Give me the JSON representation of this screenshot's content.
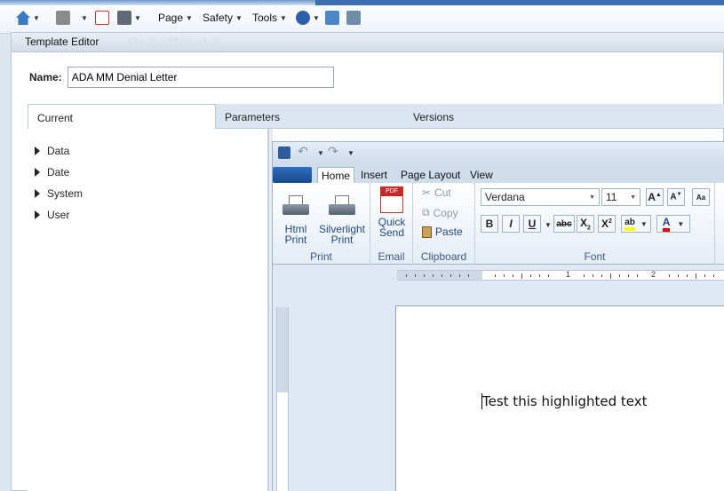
{
  "ie_toolbar": {
    "page_label": "Page",
    "safety_label": "Safety",
    "tools_label": "Tools"
  },
  "window": {
    "title": "Template Editor",
    "watermark": "CaseWorks"
  },
  "form": {
    "name_label": "Name:",
    "name_value": "ADA MM Denial Letter"
  },
  "tabs": [
    {
      "label": "Current"
    },
    {
      "label": "Parameters"
    },
    {
      "label": "Versions"
    }
  ],
  "tree": [
    {
      "label": "Data"
    },
    {
      "label": "Date"
    },
    {
      "label": "System"
    },
    {
      "label": "User"
    }
  ],
  "editor": {
    "ribbon_tabs": [
      "Home",
      "Insert",
      "Page Layout",
      "View"
    ],
    "print": {
      "html_line1": "Html",
      "html_line2": "Print",
      "sl_line1": "Silverlight",
      "sl_line2": "Print",
      "group": "Print"
    },
    "email": {
      "line1": "Quick",
      "line2": "Send",
      "group": "Email",
      "pdf_badge": "PDF"
    },
    "clipboard": {
      "cut": "Cut",
      "copy": "Copy",
      "paste": "Paste",
      "group": "Clipboard"
    },
    "font": {
      "family": "Verdana",
      "size": "11",
      "group": "Font"
    },
    "ruler": [
      "1",
      "2"
    ],
    "document_text": "Test this highlighted text"
  },
  "colors": {
    "accent": "#1f4a7d",
    "tab_strip": "#dbe5ef",
    "highlight": "#ffff00",
    "font_color": "#e00000"
  }
}
